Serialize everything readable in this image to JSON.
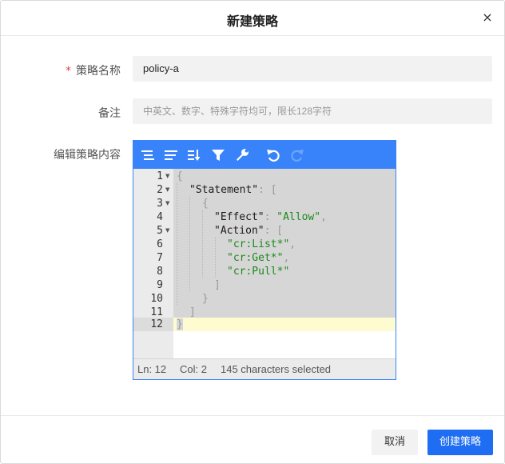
{
  "dialog": {
    "title": "新建策略",
    "close_icon": "×"
  },
  "form": {
    "name_label": "策略名称",
    "required_mark": "*",
    "name_value": "policy-a",
    "remark_label": "备注",
    "remark_placeholder": "中英文、数字、特殊字符均可，限长128字符",
    "content_label": "编辑策略内容"
  },
  "editor": {
    "toolbar_icons": [
      "format-icon",
      "compact-icon",
      "sort-icon",
      "filter-icon",
      "repair-icon",
      "undo-icon",
      "redo-icon"
    ],
    "line_numbers": [
      "1",
      "2",
      "3",
      "4",
      "5",
      "6",
      "7",
      "8",
      "9",
      "10",
      "11",
      "12"
    ],
    "code": {
      "l1": "{",
      "l2_key": "\"Statement\"",
      "l2_rest": ": [",
      "l3": "{",
      "l4_key": "\"Effect\"",
      "l4_colon": ": ",
      "l4_val": "\"Allow\"",
      "l4_comma": ",",
      "l5_key": "\"Action\"",
      "l5_rest": ": [",
      "l6_val": "\"cr:List*\"",
      "l6_comma": ",",
      "l7_val": "\"cr:Get*\"",
      "l7_comma": ",",
      "l8_val": "\"cr:Pull*\"",
      "l9": "]",
      "l10": "}",
      "l11": "]",
      "l12": "}"
    },
    "status": {
      "line": "Ln: 12",
      "col": "Col: 2",
      "selection": "145 characters selected"
    },
    "colors": {
      "toolbar": "#3883fa",
      "string": "#1a8a1a",
      "active_line": "#fffbd1"
    }
  },
  "footer": {
    "cancel_label": "取消",
    "submit_label": "创建策略"
  }
}
